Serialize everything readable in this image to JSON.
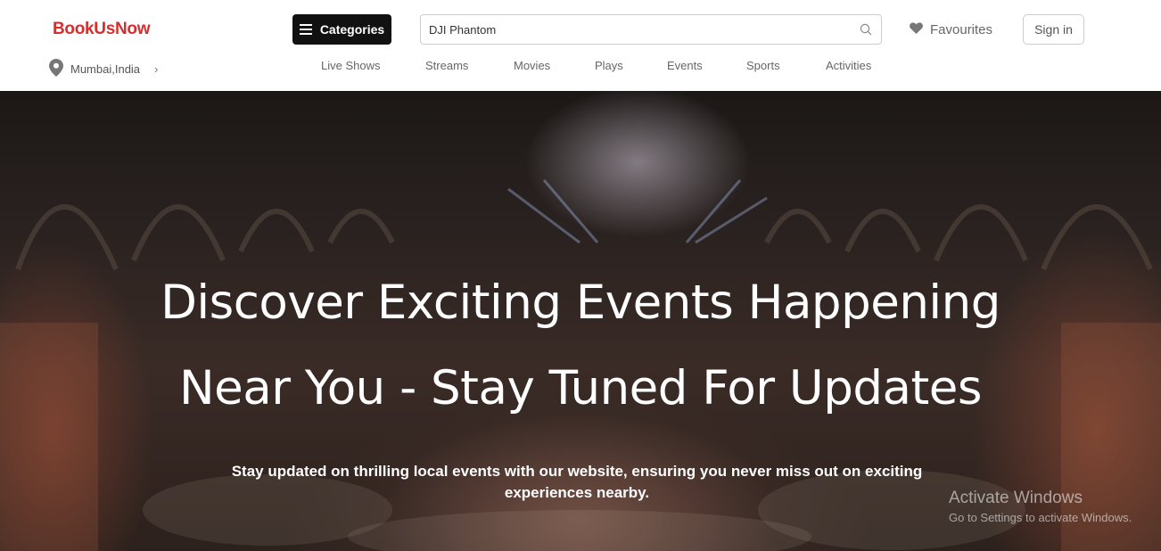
{
  "brand": {
    "name": "BookUsNow",
    "accent": "#d32f2f"
  },
  "location": {
    "icon": "map-pin-icon",
    "label": "Mumbai,India",
    "chevron": "›"
  },
  "categories_button": {
    "label": "Categories",
    "icon": "menu-icon"
  },
  "search": {
    "value": "DJI Phantom",
    "icon": "search-icon"
  },
  "favourites": {
    "label": "Favourites",
    "icon": "heart-icon"
  },
  "signin": {
    "label": "Sign in"
  },
  "nav": [
    {
      "label": "Live Shows"
    },
    {
      "label": "Streams"
    },
    {
      "label": "Movies"
    },
    {
      "label": "Plays"
    },
    {
      "label": "Events"
    },
    {
      "label": "Sports"
    },
    {
      "label": "Activities"
    }
  ],
  "hero": {
    "title_line1": "Discover Exciting Events Happening",
    "title_line2": "Near You - Stay Tuned For Updates",
    "subtitle": "Stay updated on thrilling local events with our website, ensuring you never miss out on exciting experiences nearby."
  },
  "windows_watermark": {
    "line1": "Activate Windows",
    "line2": "Go to Settings to activate Windows."
  }
}
